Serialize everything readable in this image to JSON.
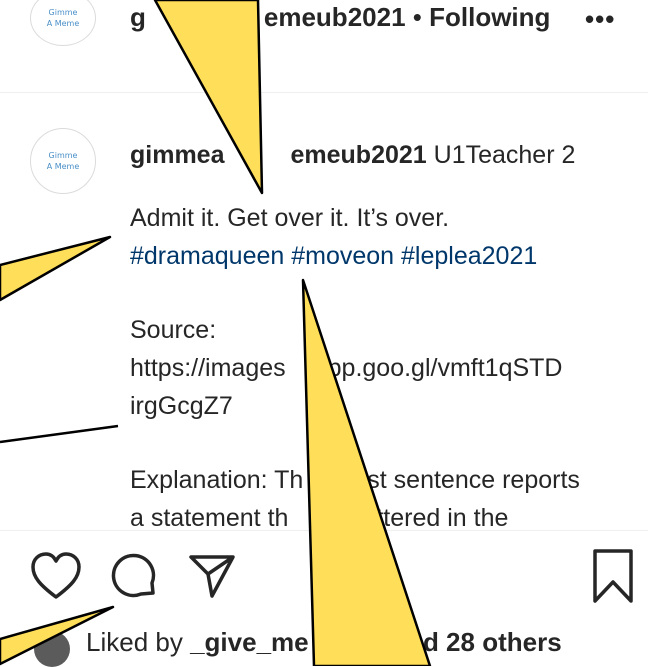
{
  "avatar": {
    "line1": "Gimme",
    "line2": "A Meme"
  },
  "header": {
    "username_start": "g",
    "username_end": "emeub2021",
    "separator": " • ",
    "follow_status": "Following",
    "more_label": "•••"
  },
  "comment": {
    "username_start": "gimmea",
    "username_end": "emeub2021",
    "meta": " U1Teacher 2",
    "line1": "Admit it. Get over it. It’s over.",
    "hashtags": "#dramaqueen #moveon #leplea2021",
    "source_label": "Source:",
    "source_url_1": "https://images",
    "source_url_2": "pp.goo.gl/vmft1qSTD",
    "source_url_3": "irgGcgZ7",
    "explanation_1a": "Explanation: Th",
    "explanation_1b": "st sentence reports",
    "explanation_2a": "a statement th",
    "explanation_2b": "uttered in the"
  },
  "likes": {
    "prefix": "Liked by ",
    "user": "_give_me",
    "suffix": "and 28 others"
  },
  "icons": [
    "heart-icon",
    "comment-icon",
    "share-icon",
    "bookmark-icon"
  ],
  "colors": {
    "callout_fill": "#FFDE59",
    "hashtag": "#00376b",
    "avatar_text": "#4a90c8"
  }
}
